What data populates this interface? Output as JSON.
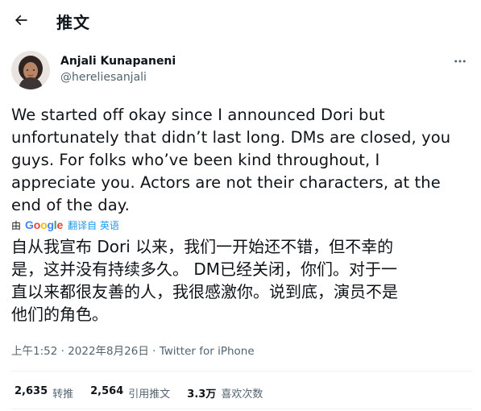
{
  "header": {
    "title": "推文",
    "back_icon": "arrow-left-icon"
  },
  "author": {
    "name": "Anjali Kunapaneni",
    "handle": "@hereliesanjali",
    "avatar_icon": "user-avatar",
    "more_icon": "more-horizontal-icon"
  },
  "tweet": {
    "text": "We started off okay since I announced Dori but\nunfortunately that didn’t last long. DMs are closed, you\nguys. For folks who’ve been kind throughout, I\nappreciate you. Actors are not their characters, at the\nend of the day."
  },
  "translation": {
    "by": "由",
    "provider": "Google",
    "translated_from": "翻译自 英语",
    "text": "自从我宣布 Dori 以来，我们一开始还不错，但不幸的\n是，这并没有持续多久。 DM已经关闭，你们。对于一\n直以来都很友善的人，我很感激你。说到底，演员不是\n他们的角色。",
    "google_colors": [
      "#4285f4",
      "#ea4335",
      "#fbbc05",
      "#4285f4",
      "#34a853",
      "#ea4335"
    ]
  },
  "meta": {
    "timestamp": "上午1:52 · 2022年8月26日",
    "separator": " · ",
    "source": "Twitter for iPhone"
  },
  "stats": {
    "retweets_count": "2,635",
    "retweets_label": "转推",
    "quotes_count": "2,564",
    "quotes_label": "引用推文",
    "likes_count": "3.3万",
    "likes_label": "喜欢次数"
  }
}
